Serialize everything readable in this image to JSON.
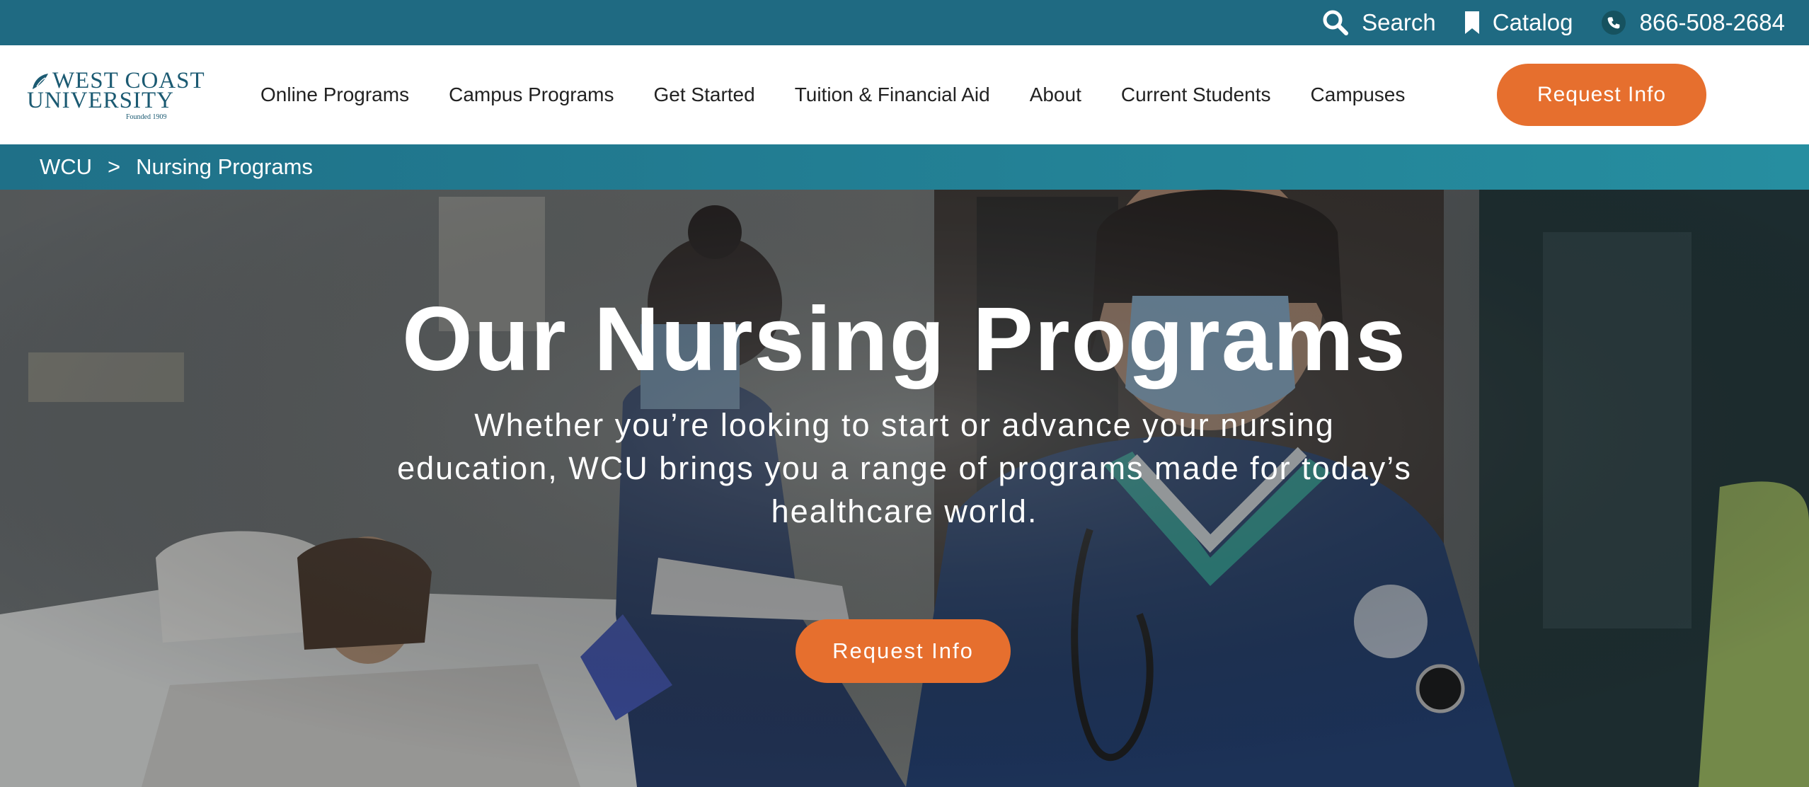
{
  "utility": {
    "search_label": "Search",
    "catalog_label": "Catalog",
    "phone": "866-508-2684",
    "icons": [
      "search-icon",
      "bookmark-icon",
      "phone-icon"
    ]
  },
  "logo": {
    "line1": "WEST COAST",
    "line2": "UNIVERSITY",
    "founded": "Founded 1909"
  },
  "nav": {
    "items": [
      {
        "label": "Online Programs"
      },
      {
        "label": "Campus Programs"
      },
      {
        "label": "Get Started"
      },
      {
        "label": "Tuition & Financial Aid"
      },
      {
        "label": "About"
      },
      {
        "label": "Current Students"
      },
      {
        "label": "Campuses"
      }
    ],
    "cta_label": "Request Info"
  },
  "breadcrumb": {
    "root": "WCU",
    "separator": ">",
    "current": "Nursing Programs"
  },
  "hero": {
    "title": "Our Nursing Programs",
    "subtitle": "Whether you’re looking to start or advance your nursing education, WCU brings you a range of programs made for today’s healthcare world.",
    "cta_label": "Request Info"
  },
  "colors": {
    "utility_bar": "#1f6a82",
    "breadcrumb_bar": "#268ea0",
    "accent_orange": "#e66f2e",
    "logo_teal": "#1b5a72"
  }
}
